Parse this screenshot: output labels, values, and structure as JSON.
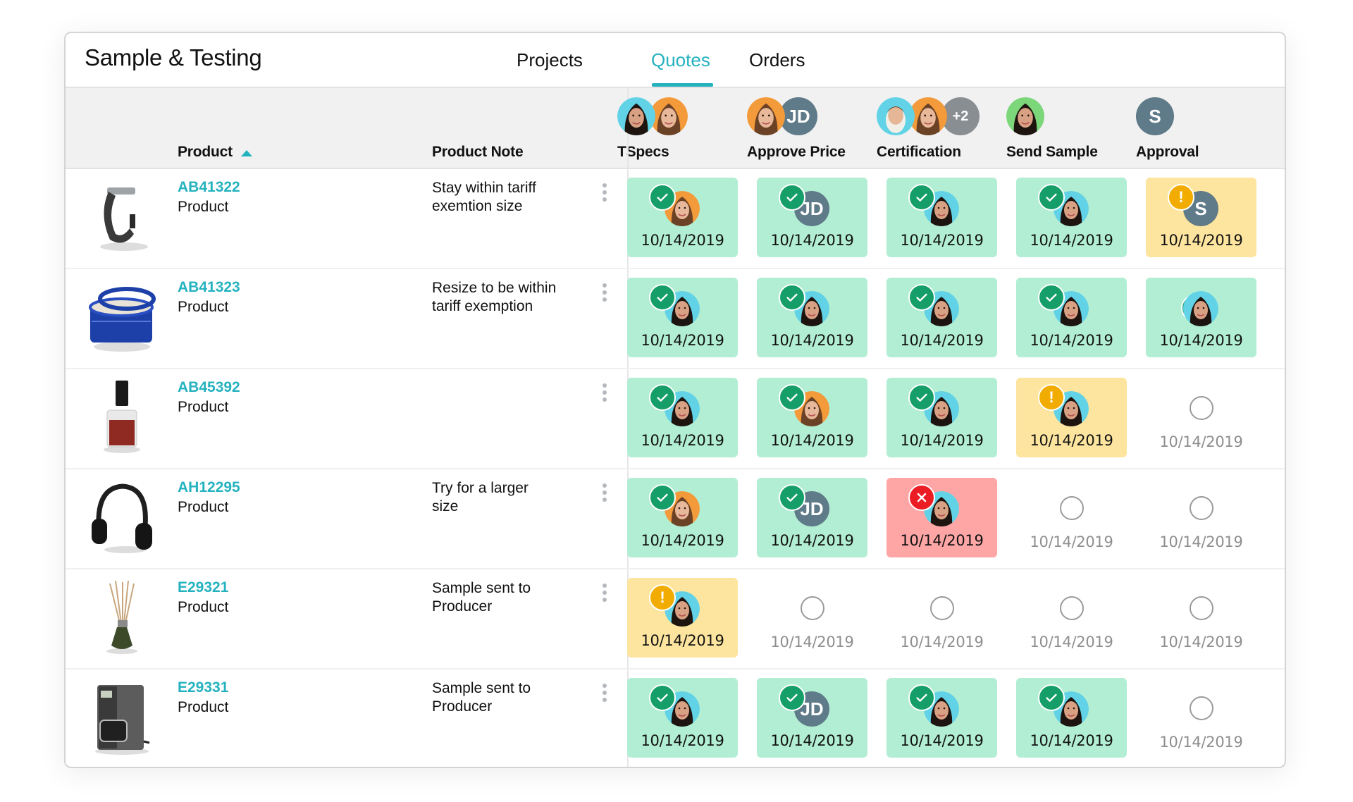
{
  "app": {
    "title": "Sample & Testing"
  },
  "tabs": [
    {
      "label": "Projects",
      "active": false
    },
    {
      "label": "Quotes",
      "active": true
    },
    {
      "label": "Orders",
      "active": false
    }
  ],
  "columns": {
    "product": "Product",
    "product_sort": "ascending",
    "product_note": "Product Note"
  },
  "stages": [
    {
      "label": "TSpecs",
      "assignees": [
        "woman-dark-hair",
        "woman-brown-hair"
      ]
    },
    {
      "label": "Approve Price",
      "assignees": [
        "woman-brown-hair",
        "JD"
      ]
    },
    {
      "label": "Certification",
      "assignees": [
        "man",
        "woman-brown-hair",
        "+2"
      ]
    },
    {
      "label": "Send Sample",
      "assignees": [
        "woman-dark-hair-green"
      ]
    },
    {
      "label": "Approval",
      "assignees": [
        "S"
      ]
    }
  ],
  "colors": {
    "accent": "#25b2bf",
    "done_bg": "#b2eed3",
    "warn_bg": "#fde59f",
    "fail_bg": "#fea6a6",
    "ok_badge": "#159e68",
    "alert_badge": "#f2ac00",
    "error_badge": "#ec1c24",
    "initials_avatar": "#5f7a88"
  },
  "rows": [
    {
      "sku": "AB41322",
      "type": "Product",
      "note": "Stay within tariff exemtion size",
      "image": "smartwatch",
      "cells": [
        {
          "status": "done",
          "assignee": "woman-brown-hair",
          "date": "10/14/2019"
        },
        {
          "status": "done",
          "assignee": "JD",
          "date": "10/14/2019"
        },
        {
          "status": "done",
          "assignee": "woman-dark-hair",
          "date": "10/14/2019"
        },
        {
          "status": "done",
          "assignee": "woman-dark-hair",
          "date": "10/14/2019"
        },
        {
          "status": "warn",
          "assignee": "S",
          "date": "10/14/2019"
        }
      ]
    },
    {
      "sku": "AB41323",
      "type": "Product",
      "note": "Resize to be within tariff exemption",
      "image": "blue-tin",
      "cells": [
        {
          "status": "done",
          "assignee": "woman-dark-hair",
          "date": "10/14/2019"
        },
        {
          "status": "done",
          "assignee": "woman-dark-hair",
          "date": "10/14/2019"
        },
        {
          "status": "done",
          "assignee": "woman-dark-hair",
          "date": "10/14/2019"
        },
        {
          "status": "done",
          "assignee": "woman-dark-hair",
          "date": "10/14/2019"
        },
        {
          "status": "done-hidden",
          "assignee": "woman-dark-hair",
          "date": "10/14/2019"
        }
      ]
    },
    {
      "sku": "AB45392",
      "type": "Product",
      "note": "",
      "image": "nail-polish",
      "cells": [
        {
          "status": "done",
          "assignee": "woman-dark-hair",
          "date": "10/14/2019"
        },
        {
          "status": "done",
          "assignee": "woman-brown-hair",
          "date": "10/14/2019"
        },
        {
          "status": "done",
          "assignee": "woman-dark-hair",
          "date": "10/14/2019"
        },
        {
          "status": "warn",
          "assignee": "woman-dark-hair",
          "date": "10/14/2019"
        },
        {
          "status": "pending",
          "assignee": "",
          "date": "10/14/2019"
        }
      ]
    },
    {
      "sku": "AH12295",
      "type": "Product",
      "note": "Try for a larger size",
      "image": "headphones",
      "cells": [
        {
          "status": "done",
          "assignee": "woman-brown-hair",
          "date": "10/14/2019"
        },
        {
          "status": "done",
          "assignee": "JD",
          "date": "10/14/2019"
        },
        {
          "status": "fail",
          "assignee": "woman-dark-hair",
          "date": "10/14/2019"
        },
        {
          "status": "pending",
          "assignee": "",
          "date": "10/14/2019"
        },
        {
          "status": "pending",
          "assignee": "",
          "date": "10/14/2019"
        }
      ]
    },
    {
      "sku": "E29321",
      "type": "Product",
      "note": "Sample sent to Producer",
      "image": "reed-diffuser",
      "cells": [
        {
          "status": "warn",
          "assignee": "woman-dark-hair",
          "date": "10/14/2019"
        },
        {
          "status": "pending",
          "assignee": "",
          "date": "10/14/2019"
        },
        {
          "status": "pending",
          "assignee": "",
          "date": "10/14/2019"
        },
        {
          "status": "pending",
          "assignee": "",
          "date": "10/14/2019"
        },
        {
          "status": "pending",
          "assignee": "",
          "date": "10/14/2019"
        }
      ]
    },
    {
      "sku": "E29331",
      "type": "Product",
      "note": "Sample sent to Producer",
      "image": "coffee-maker",
      "cells": [
        {
          "status": "done",
          "assignee": "woman-dark-hair",
          "date": "10/14/2019"
        },
        {
          "status": "done",
          "assignee": "JD",
          "date": "10/14/2019"
        },
        {
          "status": "done",
          "assignee": "woman-dark-hair",
          "date": "10/14/2019"
        },
        {
          "status": "done",
          "assignee": "woman-dark-hair",
          "date": "10/14/2019"
        },
        {
          "status": "pending",
          "assignee": "",
          "date": "10/14/2019"
        }
      ]
    }
  ]
}
